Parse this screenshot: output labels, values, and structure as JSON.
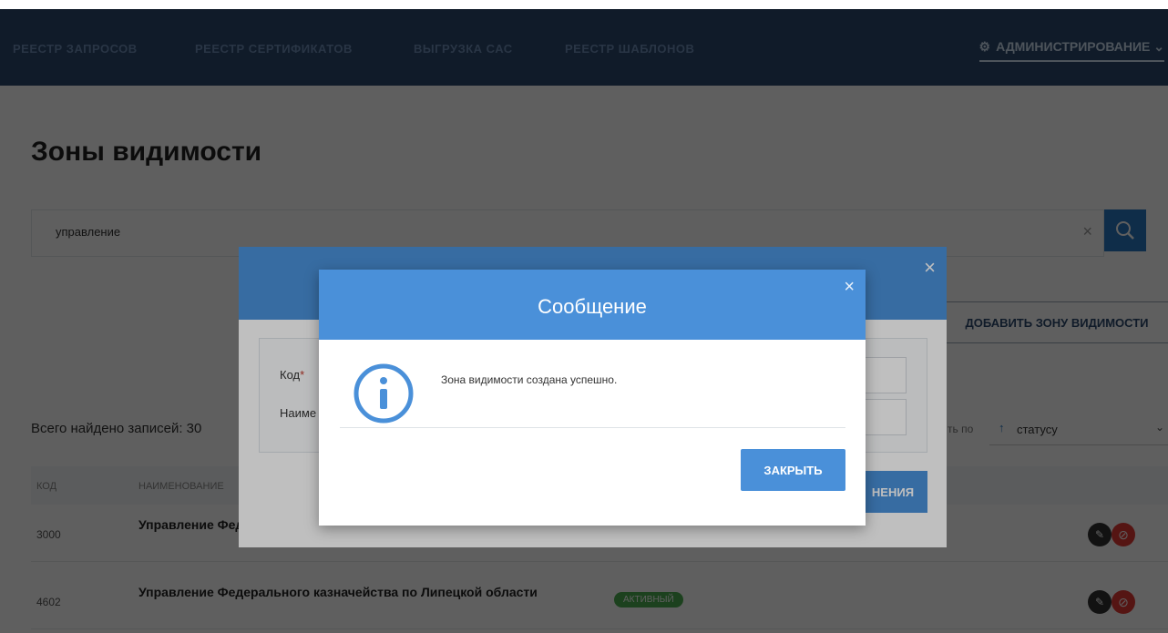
{
  "nav": {
    "items": [
      "Реестр запросов",
      "Реестр сертификатов",
      "Выгрузка САС",
      "Реестр шаблонов"
    ],
    "admin_label": "АДМИНИСТРИРОВАНИЕ"
  },
  "page": {
    "title": "Зоны видимости"
  },
  "search": {
    "value": "управление",
    "clear": "×"
  },
  "actions": {
    "add_label": "ДОБАВИТЬ ЗОНУ ВИДИМОСТИ"
  },
  "results": {
    "total": "Всего найдено записей: 30",
    "sort_prefix": "ть по",
    "sort_value": "статусу"
  },
  "table": {
    "headers": [
      "КОД",
      "НАИМЕНОВАНИЕ"
    ],
    "rows": [
      {
        "code": "3000",
        "name": "Управление Федерального казначейства по Липецкой области",
        "status": ""
      },
      {
        "code": "4602",
        "name": "Управление Федерального казначейства по Липецкой области",
        "status": "АКТИВНЫЙ"
      }
    ]
  },
  "form_modal": {
    "code_label": "Код",
    "name_label": "Наиме",
    "save_label": "НЕНИЯ",
    "close": "×"
  },
  "message_modal": {
    "title": "Сообщение",
    "text": "Зона видимости создана успешно.",
    "close_button": "ЗАКРЫТЬ",
    "close": "×"
  },
  "colors": {
    "navbar": "#2d4a6e",
    "modal_header": "#4a90d9",
    "status_active": "#4caf50",
    "danger": "#e53935"
  }
}
